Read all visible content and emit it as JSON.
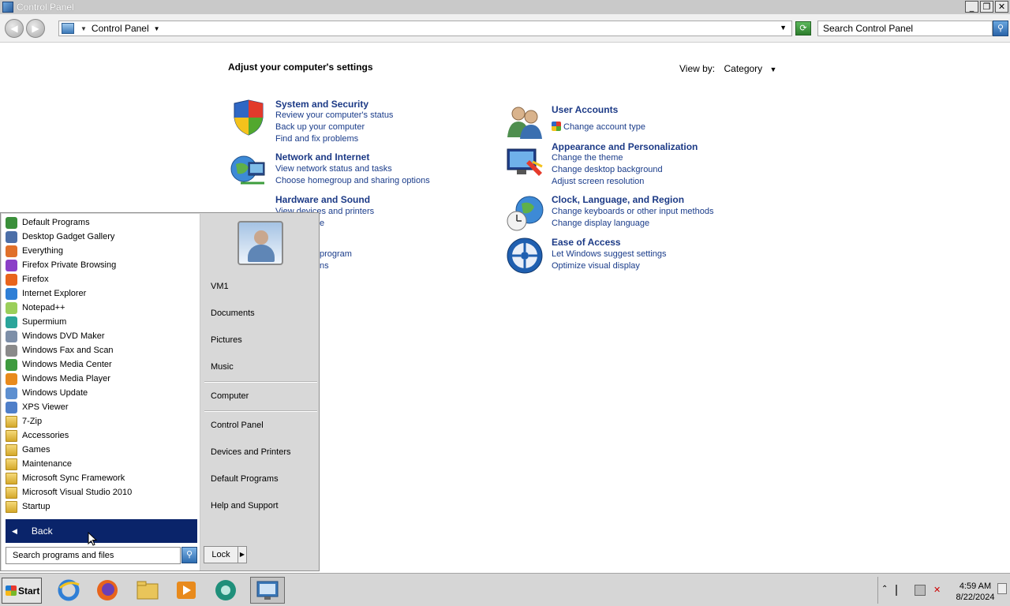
{
  "window": {
    "title": "Control Panel",
    "controls": [
      "_",
      "❐",
      "✕"
    ]
  },
  "address_bar": {
    "breadcrumb": "Control Panel",
    "search_placeholder": "Search Control Panel"
  },
  "main": {
    "heading": "Adjust your computer's settings",
    "view_by_label": "View by:",
    "view_by_value": "Category",
    "categories": [
      {
        "title": "System and Security",
        "links": [
          "Review your computer's status",
          "Back up your computer",
          "Find and fix problems"
        ],
        "icon": "shield-icon"
      },
      {
        "title": "Network and Internet",
        "links": [
          "View network status and tasks",
          "Choose homegroup and sharing options"
        ],
        "icon": "network-globe-icon"
      },
      {
        "title": "Hardware and Sound",
        "links": [
          "View devices and printers"
        ],
        "icon": "printer-icon"
      },
      {
        "title": "User Accounts",
        "links": [
          "Change account type"
        ],
        "icon": "users-icon"
      },
      {
        "title": "Appearance and Personalization",
        "links": [
          "Change the theme",
          "Change desktop background",
          "Adjust screen resolution"
        ],
        "icon": "monitor-paint-icon"
      },
      {
        "title": "Clock, Language, and Region",
        "links": [
          "Change keyboards or other input methods",
          "Change display language"
        ],
        "icon": "clock-globe-icon"
      },
      {
        "title": "Ease of Access",
        "links": [
          "Let Windows suggest settings",
          "Optimize visual display"
        ],
        "icon": "ease-of-access-icon"
      }
    ],
    "partial_texts": [
      "e",
      "program",
      "ns"
    ]
  },
  "start_menu": {
    "programs": [
      {
        "label": "Default Programs",
        "color": "#3a8f3a"
      },
      {
        "label": "Desktop Gadget Gallery",
        "color": "#4c6fa8"
      },
      {
        "label": "Everything",
        "color": "#e0702a"
      },
      {
        "label": "Firefox Private Browsing",
        "color": "#8b3fc7"
      },
      {
        "label": "Firefox",
        "color": "#e8641c"
      },
      {
        "label": "Internet Explorer",
        "color": "#2f7fd6"
      },
      {
        "label": "Notepad++",
        "color": "#9bcf5a"
      },
      {
        "label": "Supermium",
        "color": "#2aa59a"
      },
      {
        "label": "Windows DVD Maker",
        "color": "#7d8fa8"
      },
      {
        "label": "Windows Fax and Scan",
        "color": "#8a8a8a"
      },
      {
        "label": "Windows Media Center",
        "color": "#3e9a3e"
      },
      {
        "label": "Windows Media Player",
        "color": "#e88a1c"
      },
      {
        "label": "Windows Update",
        "color": "#5d8fd0"
      },
      {
        "label": "XPS Viewer",
        "color": "#4f7fc9"
      },
      {
        "label": "7-Zip",
        "color": "folder"
      },
      {
        "label": "Accessories",
        "color": "folder"
      },
      {
        "label": "Games",
        "color": "folder"
      },
      {
        "label": "Maintenance",
        "color": "folder"
      },
      {
        "label": "Microsoft Sync Framework",
        "color": "folder"
      },
      {
        "label": "Microsoft Visual Studio 2010",
        "color": "folder"
      },
      {
        "label": "Startup",
        "color": "folder"
      }
    ],
    "back_label": "Back",
    "search_placeholder": "Search programs and files",
    "right_links": [
      "VM1",
      "Documents",
      "Pictures",
      "Music",
      "Computer",
      "Control Panel",
      "Devices and Printers",
      "Default Programs",
      "Help and Support"
    ],
    "lock_label": "Lock"
  },
  "taskbar": {
    "start_label": "Start",
    "pinned": [
      "internet-explorer-icon",
      "firefox-icon",
      "file-explorer-icon",
      "media-player-icon",
      "supermium-icon",
      "control-panel-icon"
    ],
    "time": "4:59 AM",
    "date": "8/22/2024"
  }
}
